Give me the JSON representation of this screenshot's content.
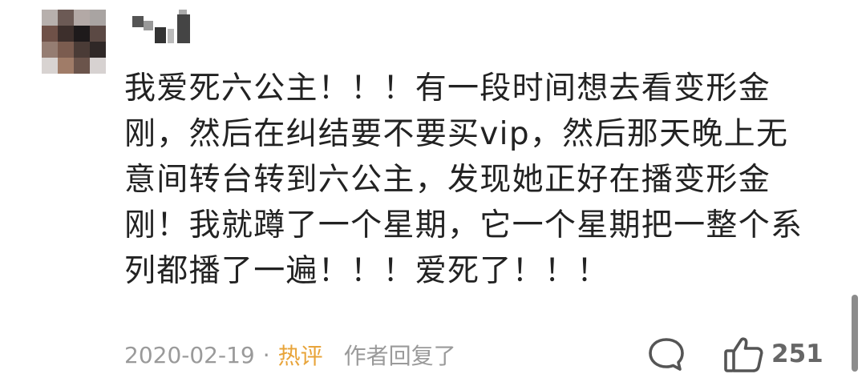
{
  "comment": {
    "lines": [
      "我爱死六公主！！！有一段时间想去看变形金",
      "刚，然后在纠结要不要买vip，然后那天晚上无",
      "意间转台转到六公主，发现她正好在播变形金",
      "刚！我就蹲了一个星期，它一个星期把一整个系",
      "列都播了一遍！！！爱死了！！！"
    ]
  },
  "meta": {
    "date": "2020-02-19",
    "separator": "·",
    "tag": "热评",
    "reply_label": "作者回复了"
  },
  "actions": {
    "comment_icon": "comment-bubble-icon",
    "like_icon": "thumbs-up-icon",
    "like_count": "251"
  },
  "colors": {
    "text": "#222222",
    "meta": "#9a9a9a",
    "hot_tag": "#e8a43a",
    "count": "#666666"
  }
}
